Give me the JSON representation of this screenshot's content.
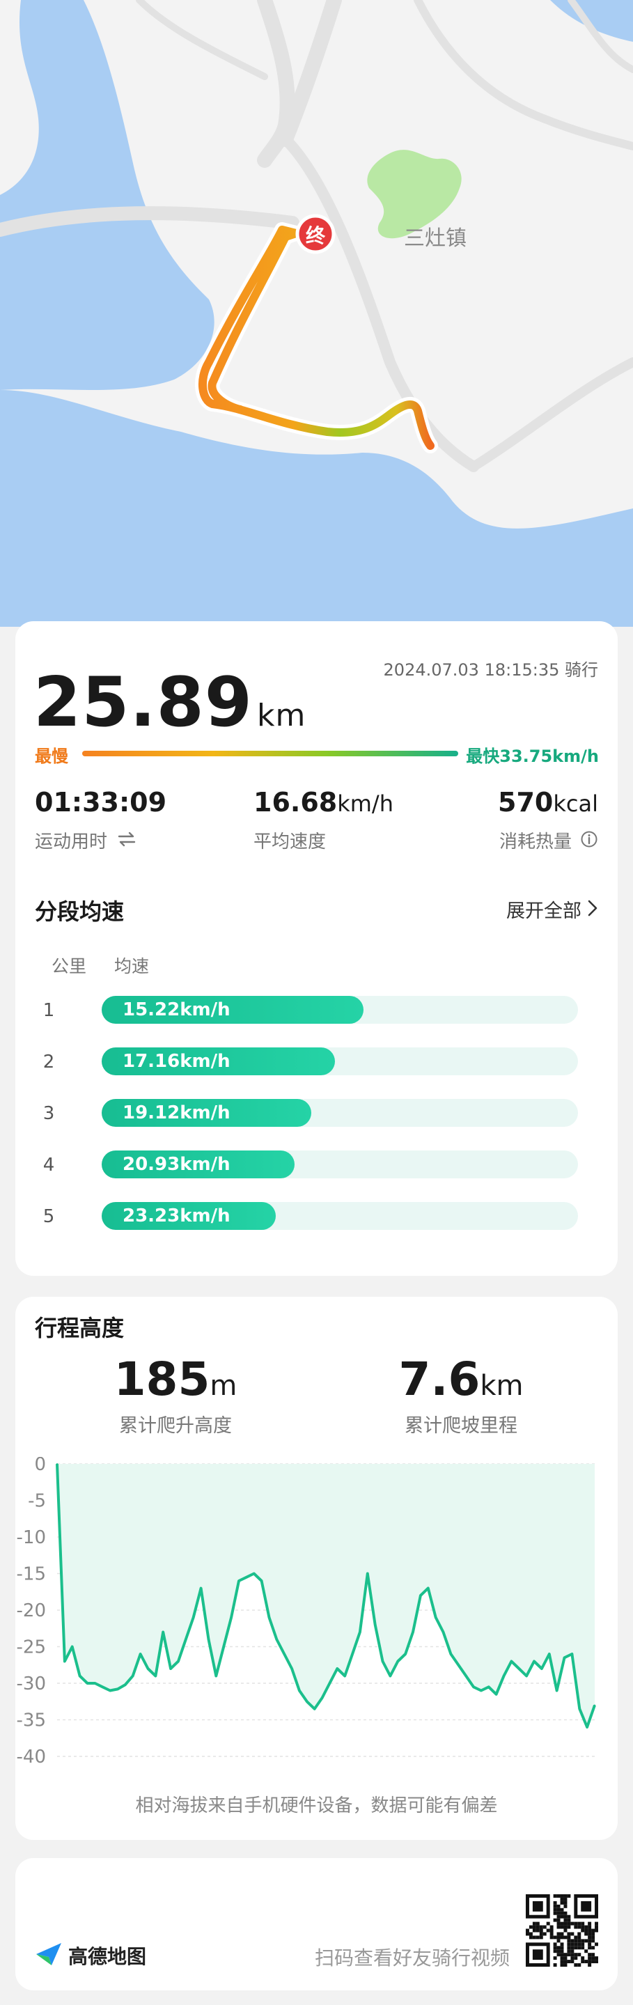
{
  "map": {
    "town_label": "三灶镇",
    "end_marker": "终",
    "colors": {
      "water": "#a9cdf3",
      "land": "#f3f3f3",
      "park": "#b9e8a4",
      "road": "#dcdcdc"
    }
  },
  "summary": {
    "distance": "25.89",
    "distance_unit": "km",
    "datetime": "2024.07.03 18:15:35 骑行",
    "slowest_label": "最慢",
    "fastest_label": "最快33.75km/h"
  },
  "stats": [
    {
      "value": "01:33:09",
      "unit": "",
      "label": "运动用时",
      "icon": "swap-icon"
    },
    {
      "value": "16.68",
      "unit": "km/h",
      "label": "平均速度",
      "icon": ""
    },
    {
      "value": "570",
      "unit": "kcal",
      "label": "消耗热量",
      "icon": "info-icon"
    }
  ],
  "segments": {
    "title": "分段均速",
    "expand_label": "展开全部",
    "col_km": "公里",
    "col_speed": "均速",
    "rows": [
      {
        "km": "1",
        "speed": "15.22km/h",
        "fraction": 0.55
      },
      {
        "km": "2",
        "speed": "17.16km/h",
        "fraction": 0.49
      },
      {
        "km": "3",
        "speed": "19.12km/h",
        "fraction": 0.44
      },
      {
        "km": "4",
        "speed": "20.93km/h",
        "fraction": 0.405
      },
      {
        "km": "5",
        "speed": "23.23km/h",
        "fraction": 0.365
      }
    ]
  },
  "elevation": {
    "title": "行程高度",
    "climb_value": "185",
    "climb_unit": "m",
    "climb_label": "累计爬升高度",
    "slope_value": "7.6",
    "slope_unit": "km",
    "slope_label": "累计爬坡里程",
    "note": "相对海拔来自手机硬件设备，数据可能有偏差"
  },
  "chart_data": {
    "type": "area",
    "title": "",
    "xlabel": "",
    "ylabel": "",
    "y_ticks": [
      "0",
      "-5",
      "-10",
      "-15",
      "-20",
      "-25",
      "-30",
      "-35",
      "-40"
    ],
    "ylim": [
      -40,
      0
    ],
    "grid": true,
    "color": "#1bbf8c",
    "series": [
      {
        "values": [
          0,
          -27,
          -25,
          -29,
          -30,
          -30,
          -30.5,
          -31,
          -30.8,
          -30.2,
          -29,
          -26,
          -28,
          -29,
          -23,
          -28,
          -27,
          -24,
          -21,
          -17,
          -24,
          -29,
          -25,
          -21,
          -16,
          -15.5,
          -15,
          -16,
          -21,
          -24,
          -26,
          -28,
          -31,
          -32.5,
          -33.5,
          -32,
          -30,
          -28,
          -29,
          -26,
          -23,
          -15,
          -22,
          -27,
          -29,
          -27,
          -26,
          -23,
          -18,
          -17,
          -21,
          -23,
          -26,
          -27.5,
          -29,
          -30.5,
          -31,
          -30.5,
          -31.5,
          -29,
          -27,
          -28,
          -29,
          -27,
          -28,
          -26,
          -31,
          -26.5,
          -26,
          -33.5,
          -36,
          -33
        ]
      }
    ]
  },
  "footer": {
    "logo_text": "高德地图",
    "scan_text": "扫码查看好友骑行视频"
  }
}
